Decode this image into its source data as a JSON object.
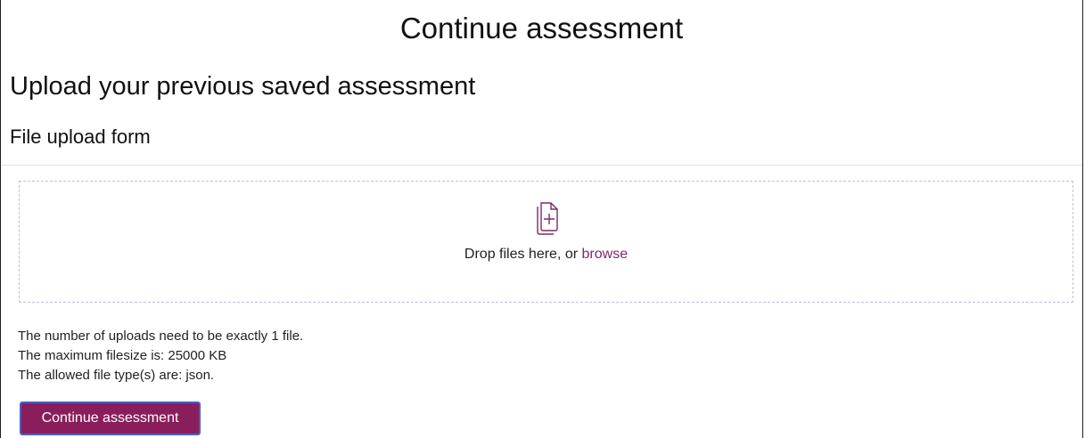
{
  "page": {
    "title": "Continue assessment",
    "subtitle": "Upload your previous saved assessment",
    "form_heading": "File upload form"
  },
  "dropzone": {
    "icon": "file-add-icon",
    "prompt": "Drop files here, or ",
    "browse_label": "browse",
    "accent_color": "#7d2a63"
  },
  "info": {
    "uploads_rule": "The number of uploads need to be exactly 1 file.",
    "max_filesize": "The maximum filesize is: 25000 KB",
    "allowed_types": "The allowed file type(s) are: json."
  },
  "actions": {
    "continue_label": "Continue assessment",
    "button_color": "#8a1e5c"
  }
}
